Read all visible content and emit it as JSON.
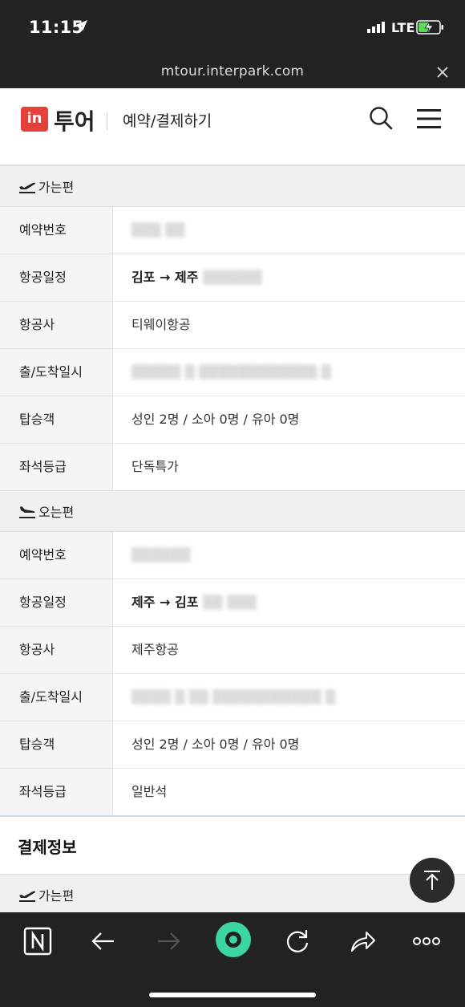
{
  "status_bar": {
    "time": "11:15",
    "network": "LTE"
  },
  "url_bar": {
    "url": "mtour.interpark.com"
  },
  "header": {
    "logo_badge": "in",
    "logo_text": "투어",
    "page_title": "예약/결제하기"
  },
  "outbound": {
    "section_label": "가는편",
    "rows": [
      {
        "label": "예약번호",
        "value": ""
      },
      {
        "label": "항공일정",
        "value": "김포 → 제주"
      },
      {
        "label": "항공사",
        "value": "티웨이항공"
      },
      {
        "label": "출/도착일시",
        "value": ""
      },
      {
        "label": "탑승객",
        "value": "성인 2명 / 소아 0명 / 유아 0명"
      },
      {
        "label": "좌석등급",
        "value": "단독특가"
      }
    ]
  },
  "inbound": {
    "section_label": "오는편",
    "rows": [
      {
        "label": "예약번호",
        "value": ""
      },
      {
        "label": "항공일정",
        "value": "제주 → 김포"
      },
      {
        "label": "항공사",
        "value": "제주항공"
      },
      {
        "label": "출/도착일시",
        "value": ""
      },
      {
        "label": "탑승객",
        "value": "성인 2명 / 소아 0명 / 유아 0명"
      },
      {
        "label": "좌석등급",
        "value": "일반석"
      }
    ]
  },
  "payment": {
    "title": "결제정보",
    "section_label": "가는편"
  },
  "colors": {
    "brand_red": "#e5413a",
    "toolbar_bg": "#222222",
    "accent_green": "#3ed6a0"
  },
  "icons": [
    "location-arrow-icon",
    "signal-icon",
    "battery-icon",
    "close-icon",
    "search-icon",
    "hamburger-menu-icon",
    "plane-takeoff-icon",
    "plane-landing-icon",
    "scroll-top-icon",
    "naver-icon",
    "back-arrow-icon",
    "forward-arrow-icon",
    "green-dot-icon",
    "reload-icon",
    "share-icon",
    "more-icon"
  ]
}
